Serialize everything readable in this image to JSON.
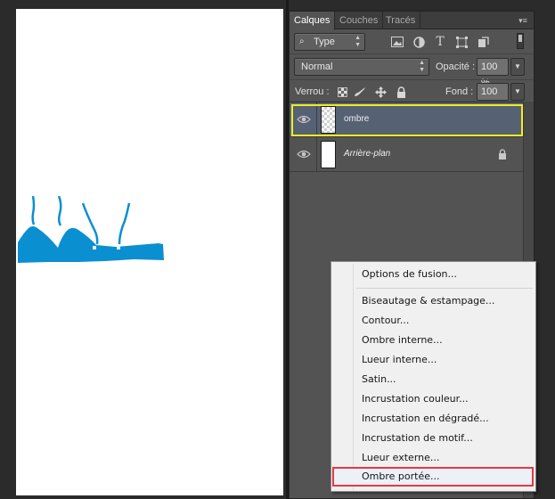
{
  "tabs": [
    "Calques",
    "Couches",
    "Tracés"
  ],
  "panel_menu_icon": "panel-menu-icon",
  "filter": {
    "kind_value": "Type",
    "icons": [
      "pixel-layer-filter-icon",
      "adjustment-layer-filter-icon",
      "type-layer-filter-icon",
      "shape-layer-filter-icon",
      "smart-object-filter-icon"
    ]
  },
  "blend": {
    "mode_value": "Normal",
    "opacity_label": "Opacité :",
    "opacity_value": "100 %"
  },
  "lock": {
    "label": "Verrou :",
    "fill_label": "Fond :",
    "fill_value": "100 %"
  },
  "layers": [
    {
      "name": "ombre",
      "selected": true,
      "visible": true
    },
    {
      "name": "Arrière-plan",
      "locked": true,
      "visible": true
    }
  ],
  "context_menu": {
    "items": [
      "Options de fusion...",
      "Biseautage & estampage...",
      "Contour...",
      "Ombre interne...",
      "Lueur interne...",
      "Satin...",
      "Incrustation couleur...",
      "Incrustation en dégradé...",
      "Incrustation de motif...",
      "Lueur externe...",
      "Ombre portée..."
    ],
    "highlighted_item": "Ombre portée..."
  },
  "colors": {
    "garment": "#0a8fd0",
    "selection_outline": "#f2ee20",
    "menu_highlight_border": "#e03a46",
    "selected_layer": "#566174"
  }
}
